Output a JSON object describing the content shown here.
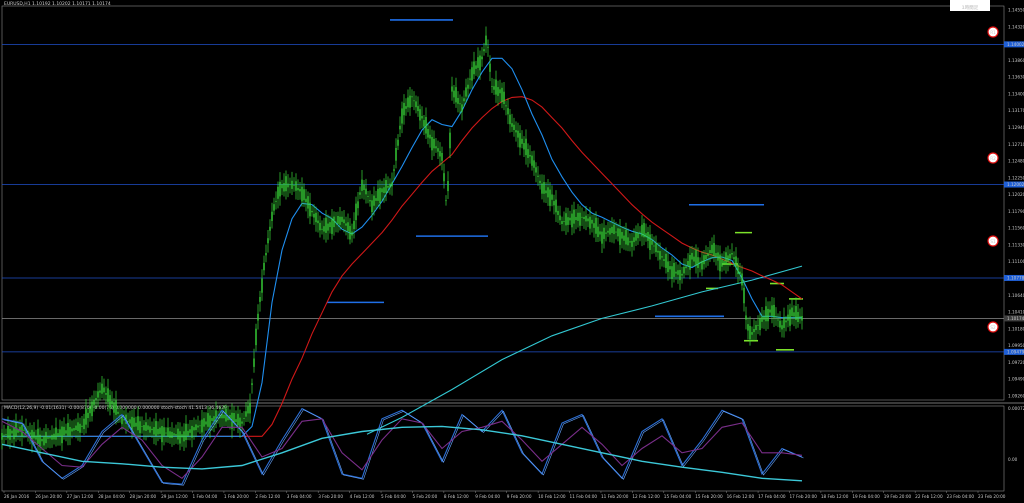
{
  "chart_data": [
    {
      "type": "line",
      "title": "EURUSD,H1  1.10192 1.10202 1.10171 1.10174",
      "badge": "1時間足",
      "ylim": [
        1.09,
        1.1465
      ],
      "y_ticks": [
        "1.14550",
        "1.14320",
        "1.14090",
        "1.13860",
        "1.13630",
        "1.13400",
        "1.13170",
        "1.12940",
        "1.12710",
        "1.12480",
        "1.12250",
        "1.12020",
        "1.11790",
        "1.11560",
        "1.11330",
        "1.11100",
        "1.10870",
        "1.10640",
        "1.10410",
        "1.10180",
        "1.09950",
        "1.09720",
        "1.09490",
        "1.09260"
      ],
      "x_ticks": [
        "26 Jan 2016",
        "26 Jan 20:00",
        "27 Jan 12:00",
        "28 Jan 04:00",
        "28 Jan 20:00",
        "29 Jan 12:00",
        "1 Feb 04:00",
        "1 Feb 20:00",
        "2 Feb 12:00",
        "3 Feb 04:00",
        "3 Feb 20:00",
        "4 Feb 12:00",
        "5 Feb 04:00",
        "5 Feb 20:00",
        "8 Feb 12:00",
        "9 Feb 04:00",
        "9 Feb 20:00",
        "10 Feb 12:00",
        "11 Feb 04:00",
        "11 Feb 20:00",
        "12 Feb 12:00",
        "15 Feb 04:00",
        "15 Feb 20:00",
        "16 Feb 12:00",
        "17 Feb 04:00",
        "17 Feb 20:00",
        "18 Feb 12:00",
        "19 Feb 04:00",
        "19 Feb 20:00",
        "22 Feb 12:00",
        "23 Feb 04:00",
        "23 Feb 20:00"
      ],
      "price_tags": [
        {
          "value": "1.14002",
          "level": 1.141,
          "color": "#1f5fd6"
        },
        {
          "value": "1.12002",
          "level": 1.1209,
          "color": "#1f5fd6"
        },
        {
          "value": "1.10778",
          "level": 1.1075,
          "color": "#1f5fd6"
        },
        {
          "value": "1.10174",
          "level": 1.1017,
          "color": "#404040"
        },
        {
          "value": "1.09479",
          "level": 1.0969,
          "color": "#1f5fd6"
        }
      ],
      "circle_markers": [
        "R1",
        "R2",
        "S1",
        "S2"
      ],
      "series": [
        {
          "role": "price",
          "color": "#3bd33b",
          "x": [
            0,
            20,
            40,
            60,
            80,
            100,
            120,
            140,
            160,
            180,
            200,
            220,
            240,
            248,
            256,
            262,
            270,
            278,
            290,
            300,
            310,
            320,
            330,
            340,
            350,
            360,
            370,
            380,
            390,
            400,
            410,
            420,
            430,
            440,
            445,
            450,
            460,
            470,
            480,
            485,
            490,
            500,
            510,
            520,
            530,
            540,
            550,
            560,
            570,
            580,
            590,
            600,
            610,
            620,
            630,
            640,
            650,
            660,
            670,
            680,
            690,
            700,
            710,
            720,
            730,
            740,
            745,
            750,
            760,
            770,
            780,
            790,
            800
          ],
          "y": [
            1.0849,
            1.0858,
            1.0842,
            1.0853,
            1.0862,
            1.0918,
            1.0873,
            1.0862,
            1.0854,
            1.0848,
            1.0865,
            1.0878,
            1.0868,
            1.089,
            1.102,
            1.109,
            1.1165,
            1.1205,
            1.121,
            1.1198,
            1.117,
            1.1145,
            1.1152,
            1.116,
            1.1138,
            1.121,
            1.118,
            1.12,
            1.121,
            1.131,
            1.1335,
            1.1305,
            1.127,
            1.125,
            1.117,
            1.1345,
            1.132,
            1.137,
            1.139,
            1.142,
            1.135,
            1.134,
            1.1295,
            1.127,
            1.1245,
            1.1205,
            1.119,
            1.1155,
            1.116,
            1.1162,
            1.1155,
            1.1135,
            1.1145,
            1.1135,
            1.1125,
            1.1145,
            1.1125,
            1.1105,
            1.1085,
            1.108,
            1.1105,
            1.1095,
            1.1118,
            1.1095,
            1.111,
            1.1075,
            1.1005,
            1.0995,
            1.1015,
            1.103,
            1.1005,
            1.1025,
            1.1018
          ]
        },
        {
          "role": "ma-fast",
          "color": "#1f8ff0",
          "x": [
            0,
            240,
            250,
            260,
            270,
            280,
            290,
            300,
            310,
            320,
            330,
            340,
            350,
            360,
            370,
            380,
            390,
            400,
            410,
            420,
            430,
            440,
            450,
            460,
            470,
            480,
            490,
            500,
            510,
            520,
            530,
            540,
            550,
            560,
            570,
            580,
            590,
            600,
            610,
            620,
            630,
            640,
            650,
            660,
            670,
            680,
            690,
            700,
            710,
            720,
            730,
            740,
            750,
            760,
            770,
            780,
            790,
            800
          ],
          "y": [
            1.0848,
            1.0848,
            1.0862,
            1.0925,
            1.104,
            1.1115,
            1.116,
            1.1182,
            1.118,
            1.1168,
            1.116,
            1.1145,
            1.1138,
            1.1148,
            1.1165,
            1.1185,
            1.121,
            1.1235,
            1.1262,
            1.1287,
            1.1302,
            1.1295,
            1.1292,
            1.1315,
            1.1345,
            1.137,
            1.139,
            1.139,
            1.1375,
            1.1345,
            1.131,
            1.128,
            1.1245,
            1.122,
            1.1198,
            1.118,
            1.1168,
            1.1162,
            1.1155,
            1.1148,
            1.1142,
            1.1138,
            1.113,
            1.1118,
            1.1108,
            1.1095,
            1.109,
            1.1098,
            1.1104,
            1.1105,
            1.11,
            1.1075,
            1.1045,
            1.102,
            1.102,
            1.1018,
            1.1018,
            1.1018
          ]
        },
        {
          "role": "ma-mid",
          "color": "#d01818",
          "x": [
            0,
            260,
            270,
            280,
            290,
            300,
            310,
            320,
            330,
            340,
            350,
            360,
            370,
            380,
            390,
            400,
            410,
            420,
            430,
            440,
            450,
            460,
            470,
            480,
            490,
            500,
            510,
            520,
            530,
            540,
            550,
            560,
            570,
            580,
            590,
            600,
            610,
            620,
            630,
            640,
            650,
            660,
            670,
            680,
            690,
            700,
            710,
            720,
            730,
            740,
            750,
            760,
            770,
            780,
            790,
            800
          ],
          "y": [
            1.0848,
            1.0848,
            1.0865,
            1.0895,
            1.093,
            1.096,
            1.0995,
            1.1025,
            1.1055,
            1.1078,
            1.1095,
            1.111,
            1.1125,
            1.114,
            1.1158,
            1.1178,
            1.1195,
            1.1212,
            1.1228,
            1.124,
            1.1252,
            1.1272,
            1.129,
            1.1305,
            1.1318,
            1.1328,
            1.1334,
            1.1335,
            1.133,
            1.132,
            1.1305,
            1.129,
            1.1272,
            1.1255,
            1.124,
            1.1225,
            1.121,
            1.1195,
            1.118,
            1.1167,
            1.1155,
            1.1145,
            1.1135,
            1.1125,
            1.1118,
            1.1112,
            1.1108,
            1.1102,
            1.1096,
            1.109,
            1.1085,
            1.1078,
            1.1072,
            1.1065,
            1.1055,
            1.1045
          ]
        },
        {
          "role": "ma-slow",
          "color": "#32c8d2",
          "x": [
            365,
            400,
            450,
            500,
            550,
            600,
            650,
            700,
            750,
            800
          ],
          "y": [
            1.0851,
            1.0875,
            1.0915,
            1.0958,
            1.0992,
            1.1017,
            1.1035,
            1.1055,
            1.1072,
            1.1092
          ]
        }
      ],
      "h_levels": [
        {
          "kind": "blue",
          "level": 1.141
        },
        {
          "kind": "blue",
          "level": 1.1209
        },
        {
          "kind": "blue",
          "level": 1.1075
        },
        {
          "kind": "gray",
          "level": 1.1017
        },
        {
          "kind": "blue",
          "level": 1.0969
        }
      ],
      "short_segments": [
        {
          "color": "#1f6fe8",
          "x": [
            388,
            451
          ],
          "y": 1.1445
        },
        {
          "color": "#1f6fe8",
          "x": [
            414,
            486
          ],
          "y": 1.1135
        },
        {
          "color": "#1f6fe8",
          "x": [
            325,
            382
          ],
          "y": 1.104
        },
        {
          "color": "#1f6fe8",
          "x": [
            653,
            722
          ],
          "y": 1.102
        },
        {
          "color": "#1f6fe8",
          "x": [
            687,
            762
          ],
          "y": 1.118
        },
        {
          "color": "#7ce22a",
          "x": [
            733,
            750
          ],
          "y": 1.114
        },
        {
          "color": "#7ce22a",
          "x": [
            720,
            736
          ],
          "y": 1.1095
        },
        {
          "color": "#7ce22a",
          "x": [
            704,
            716
          ],
          "y": 1.106
        },
        {
          "color": "#7ce22a",
          "x": [
            742,
            756
          ],
          "y": 1.0985
        },
        {
          "color": "#7ce22a",
          "x": [
            768,
            782
          ],
          "y": 1.1067
        },
        {
          "color": "#7ce22a",
          "x": [
            787,
            801
          ],
          "y": 1.1045
        },
        {
          "color": "#7ce22a",
          "x": [
            774,
            792
          ],
          "y": 1.0972
        }
      ]
    },
    {
      "type": "line",
      "title": "MACD(12,26,9) -0.01(1631) -0.00(870) -0.00(76) 0.000000 0.000000 stoch-stoch 41.5413 36.4629",
      "y_ticks": [
        "0.000724",
        "0.00"
      ],
      "series": [
        {
          "role": "stoch-main",
          "color": "#2c6fd6",
          "x": [
            0,
            20,
            40,
            60,
            80,
            100,
            120,
            140,
            160,
            180,
            200,
            220,
            240,
            260,
            280,
            300,
            320,
            340,
            360,
            380,
            400,
            420,
            440,
            460,
            480,
            500,
            520,
            540,
            560,
            580,
            600,
            620,
            640,
            660,
            680,
            700,
            720,
            740,
            760,
            780,
            800
          ],
          "y": [
            0.85,
            0.8,
            0.35,
            0.15,
            0.3,
            0.7,
            0.9,
            0.5,
            0.1,
            0.08,
            0.6,
            0.95,
            0.7,
            0.2,
            0.6,
            0.97,
            0.85,
            0.2,
            0.15,
            0.85,
            0.95,
            0.8,
            0.35,
            0.9,
            0.7,
            0.95,
            0.45,
            0.2,
            0.8,
            0.9,
            0.4,
            0.15,
            0.7,
            0.85,
            0.3,
            0.6,
            0.95,
            0.85,
            0.2,
            0.5,
            0.4
          ]
        },
        {
          "role": "stoch-signal",
          "color": "#7a2e8a",
          "x": [
            0,
            20,
            40,
            60,
            80,
            100,
            120,
            140,
            160,
            180,
            200,
            220,
            240,
            260,
            280,
            300,
            320,
            340,
            360,
            380,
            400,
            420,
            440,
            460,
            480,
            500,
            520,
            540,
            560,
            580,
            600,
            620,
            640,
            660,
            680,
            700,
            720,
            740,
            760,
            780,
            800
          ],
          "y": [
            0.82,
            0.7,
            0.5,
            0.3,
            0.28,
            0.55,
            0.75,
            0.6,
            0.3,
            0.15,
            0.4,
            0.75,
            0.75,
            0.4,
            0.5,
            0.82,
            0.85,
            0.45,
            0.25,
            0.6,
            0.85,
            0.8,
            0.5,
            0.7,
            0.75,
            0.82,
            0.6,
            0.35,
            0.55,
            0.75,
            0.55,
            0.3,
            0.5,
            0.65,
            0.45,
            0.5,
            0.75,
            0.8,
            0.45,
            0.45,
            0.42
          ]
        },
        {
          "role": "macd-main",
          "color": "#3cc8d8",
          "x": [
            0,
            40,
            80,
            120,
            160,
            200,
            240,
            280,
            320,
            360,
            400,
            440,
            480,
            520,
            560,
            600,
            640,
            680,
            720,
            760,
            800
          ],
          "y": [
            0.55,
            0.45,
            0.35,
            0.32,
            0.28,
            0.26,
            0.3,
            0.45,
            0.62,
            0.7,
            0.75,
            0.76,
            0.72,
            0.65,
            0.55,
            0.45,
            0.35,
            0.28,
            0.22,
            0.15,
            0.12
          ]
        }
      ]
    }
  ]
}
